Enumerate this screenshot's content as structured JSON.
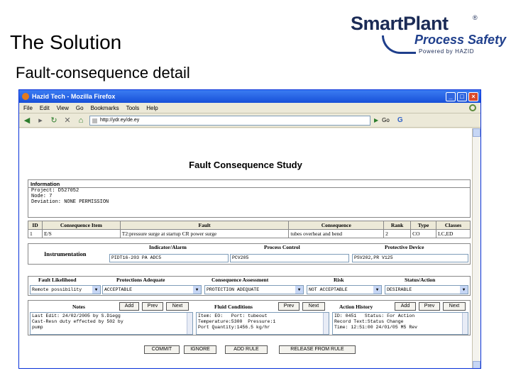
{
  "slide": {
    "title": "The Solution",
    "subtitle": "Fault-consequence detail"
  },
  "logo": {
    "main": "SmartPlant",
    "reg": "®",
    "sub": "Process Safety",
    "powered": "Powered by HAZID"
  },
  "browser": {
    "title": "Hazid Tech - Mozilla Firefox",
    "menu": [
      "File",
      "Edit",
      "View",
      "Go",
      "Bookmarks",
      "Tools",
      "Help"
    ],
    "url": "http://ydr.ey/de.ey",
    "go_label": "Go",
    "google": "G"
  },
  "page": {
    "title": "Fault Consequence Study",
    "info": {
      "heading": "Information",
      "lines": [
        "Project: D527052",
        "Node: 7",
        "Deviation: NONE PERMISSION"
      ]
    },
    "fault_table": {
      "headers": [
        "ID",
        "Consequence Item",
        "Fault",
        "Consequence",
        "Rank",
        "Type",
        "Classes"
      ],
      "row": [
        "1",
        "E/S",
        "T2:pressure surge at startup CR power surge",
        "tubes overheat and bend",
        "2",
        "CO",
        "LC,ED"
      ]
    },
    "instrumentation": {
      "label": "Instrumentation",
      "headers": [
        "Indicator/Alarm",
        "Process Control",
        "Protective Device"
      ],
      "values": [
        "PIDT16-203 PA ADC5",
        "PCV205",
        "PSV202,PR V125"
      ]
    },
    "assessment": {
      "headers": [
        "Fault Likelihood",
        "Protections Adequate",
        "Consequence Assessment",
        "Risk",
        "Status/Action"
      ],
      "values": [
        "Remote possibility",
        "ACCEPTABLE",
        "PROTECTION ADEQUATE",
        "NOT ACCEPTABLE",
        "DESIRABLE"
      ]
    },
    "notes": {
      "header": "Notes",
      "buttons": [
        "Add",
        "Prev",
        "Next"
      ],
      "text": [
        "Last Edit: 24/02/2005 by S.Diegg",
        "Cast-Resn duty effected by 502 by",
        "pump"
      ]
    },
    "fluid": {
      "header": "Fluid Conditions",
      "buttons": [
        "Prev",
        "Next"
      ],
      "text": [
        "Item: EO:   Port: tubeout",
        "Temperature:5300  Pressure:1",
        "Port Quantity:1456.5 kg/hr"
      ]
    },
    "action": {
      "header": "Action History",
      "buttons": [
        "Add",
        "Prev",
        "Next"
      ],
      "text": [
        "ID: 0451   Status: For Action",
        "Record Text:Status Change",
        "Time: 12:51:00 24/01/05 M5 Rev"
      ]
    },
    "footer_buttons": [
      "COMMIT",
      "IGNORE",
      "ADD RULE",
      "RELEASE FROM RULE"
    ]
  }
}
